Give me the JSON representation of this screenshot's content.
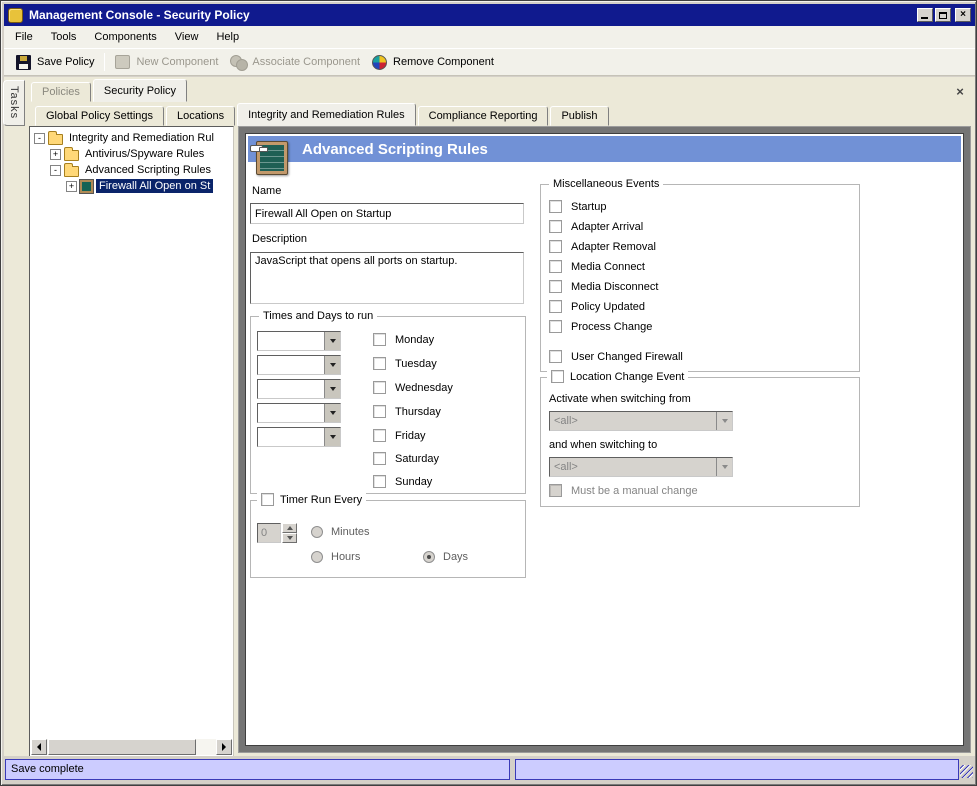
{
  "window": {
    "title": "Management Console - Security Policy",
    "controls": {
      "close_glyph": "×"
    }
  },
  "menu": {
    "items": [
      "File",
      "Tools",
      "Components",
      "View",
      "Help"
    ]
  },
  "toolbar": {
    "buttons": [
      {
        "label": "Save Policy",
        "icon": "save-icon",
        "enabled": true
      },
      {
        "label": "New Component",
        "icon": "new-component-icon",
        "enabled": false
      },
      {
        "label": "Associate Component",
        "icon": "associate-component-icon",
        "enabled": false
      },
      {
        "label": "Remove Component",
        "icon": "remove-component-icon",
        "enabled": true
      }
    ]
  },
  "side": {
    "tasks_tab": "Tasks"
  },
  "tabs": {
    "primary": [
      {
        "label": "Policies",
        "state": "disabled"
      },
      {
        "label": "Security Policy",
        "state": "active"
      }
    ],
    "secondary": [
      {
        "label": "Global Policy Settings",
        "state": "normal"
      },
      {
        "label": "Locations",
        "state": "normal"
      },
      {
        "label": "Integrity and Remediation Rules",
        "state": "active"
      },
      {
        "label": "Compliance Reporting",
        "state": "normal"
      },
      {
        "label": "Publish",
        "state": "normal"
      }
    ],
    "close_icon": "×"
  },
  "tree": {
    "items": [
      {
        "label": "Integrity and Remediation Rul",
        "expander": "-",
        "icon": "folder-icon",
        "level": 0,
        "selected": false
      },
      {
        "label": "Antivirus/Spyware Rules",
        "expander": "+",
        "icon": "folder-icon",
        "level": 1,
        "selected": false
      },
      {
        "label": "Advanced Scripting Rules",
        "expander": "-",
        "icon": "folder-icon",
        "level": 1,
        "selected": false
      },
      {
        "label": "Firewall All Open on St",
        "expander": "+",
        "icon": "script-icon",
        "level": 2,
        "selected": true
      }
    ]
  },
  "panel": {
    "header": {
      "title": "Advanced Scripting Rules",
      "icon": "chalkboard-pointer-icon"
    },
    "form": {
      "name_label": "Name",
      "name_value": "Firewall All Open on Startup",
      "description_label": "Description",
      "description_value": "JavaScript that opens all ports on startup.",
      "times_group": {
        "title": "Times and Days to run",
        "time_slots": [
          "",
          "",
          "",
          "",
          ""
        ],
        "days": [
          {
            "label": "Monday",
            "checked": false
          },
          {
            "label": "Tuesday",
            "checked": false
          },
          {
            "label": "Wednesday",
            "checked": false
          },
          {
            "label": "Thursday",
            "checked": false
          },
          {
            "label": "Friday",
            "checked": false
          },
          {
            "label": "Saturday",
            "checked": false
          },
          {
            "label": "Sunday",
            "checked": false
          }
        ]
      },
      "timer_group": {
        "title": "Timer Run Every",
        "title_checked": false,
        "spinner_value": "0",
        "radios": [
          {
            "label": "Minutes",
            "selected": false
          },
          {
            "label": "Hours",
            "selected": false
          },
          {
            "label": "Days",
            "selected": true
          }
        ]
      },
      "misc_group": {
        "title": "Miscellaneous Events",
        "events": [
          {
            "label": "Startup",
            "checked": false
          },
          {
            "label": "Adapter Arrival",
            "checked": false
          },
          {
            "label": "Adapter Removal",
            "checked": false
          },
          {
            "label": "Media Connect",
            "checked": false
          },
          {
            "label": "Media Disconnect",
            "checked": false
          },
          {
            "label": "Policy Updated",
            "checked": false
          },
          {
            "label": "Process Change",
            "checked": false
          },
          {
            "label": "User Changed Firewall",
            "checked": false
          }
        ]
      },
      "location_group": {
        "title": "Location Change Event",
        "title_checked": false,
        "from_label": "Activate when switching from",
        "from_value": "<all>",
        "to_label": "and when switching to",
        "to_value": "<all>",
        "manual_label": "Must be a manual change",
        "manual_checked": false
      }
    }
  },
  "statusbar": {
    "left": "Save complete",
    "right": ""
  },
  "colors": {
    "titlebar": "#101A8E",
    "banner": "#7191D6",
    "selection": "#0A246A",
    "statusbar_panel": "#CCCCFF",
    "statusbar_border": "#3A3AB8",
    "chrome": "#ECE9D8"
  }
}
